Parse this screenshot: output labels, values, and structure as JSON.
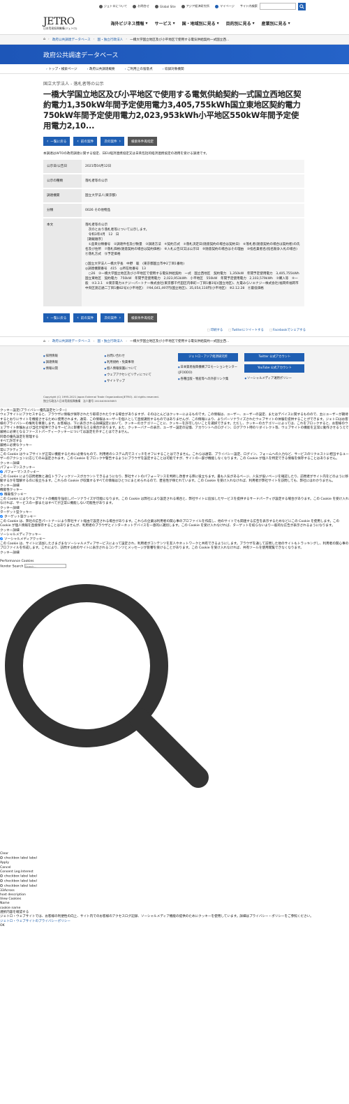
{
  "util": {
    "about": "ジェトロについて",
    "contact": "お問合せ",
    "global": "Global Site",
    "ide": "アジア経済研究所",
    "mypage": "マイページ",
    "search_label": "サイト内検索"
  },
  "logo": {
    "mark": "JETRO",
    "sub": "日本貿易振興機構(ジェトロ)"
  },
  "gnav": [
    "海外ビジネス情報",
    "サービス",
    "国・地域別に見る",
    "目的別に見る",
    "産業別に見る"
  ],
  "crumb": [
    "政府公共調達データベース",
    "国・独立行政法人",
    "一橋大学国立地区及び小平地区で使用する電気供給契約一式国立西..."
  ],
  "banner": "政府公共調達データベース",
  "subnav": [
    "トップ・検索ページ",
    "政府公共調達概要",
    "ご利用上の留意点",
    "収録対象機関"
  ],
  "category": "国立大学法人 - 落札者等の公示",
  "title": "一橋大学国立地区及び小平地区で使用する電気供給契約一式国立西地区契約電力1,350kW年間予定使用電力3,405,755kWh国立東地区契約電力750kW年間予定使用電力2,023,953kWh小平地区550kW年間予定使用電力2,10...",
  "buttons": {
    "back": "一覧に戻る",
    "prev": "前の案件",
    "next": "次の案件",
    "related": "検索条件再指定"
  },
  "note": "本調達はWTOの政府調達に関する協定、日EU経済連携協定又は日英包括的経済連携協定の適用を受ける調達です。",
  "table": [
    {
      "k": "公示日/公告日",
      "v": "2021年04月12日"
    },
    {
      "k": "公示の種類",
      "v": "落札者等の公示"
    },
    {
      "k": "調達機関",
      "v": "国立大学法人(東京都)"
    },
    {
      "k": "分類",
      "v": "0026 その他物品"
    }
  ],
  "body_label": "本文",
  "body_text": [
    "落札者等の公示",
    "　次のとおり落札者等について公示します。",
    "　令和3年4月　12　日",
    "［期載順序］",
    "　①品目分類番号　②調達件名及び数量　③調達方法　④契約方式　⑤落札決定日(随意契約の場合は契約日)　⑥落札者(随意契約の場合は契約者)の氏名及び住所　⑦落札価格(随意契約の場合は契約価格)　⑧入札公告日又は公示日　⑨随意契約の場合はその理由　⑩指名業者名(指名競争入札の場合)　⑪落札方式　⑫予定価格",
    "",
    "○国立大学法人一橋大学長　中野　聡　(東京都国立市中2丁目1番地)",
    "◎調達機関番号　415　◎所在地番号　13",
    "　○26　②一橋大学国立地区及び小平地区で使用する電気供給契約　一式　国立西地区　契約電力　1,350kW　年間予定使用電力　3,405,755kWh　国立東地区　契約電力　750kW　年間予定使用電力　2,023,953kWh　小平地区　550kW　年間予定使用電力　2,103,579kWh　③購入等　④一般　⑤3.3.1　⑥東京電力エナジーパートナー株式会社(東京都千代田区内幸町一丁目1番3号)(国立地区)、九電みらいエナジー株式会社(福岡県福岡市中央区渡辺通二丁目1番82号)(小平地区)　⑦94,041,497円(国立地区)、35,054,110円(小平地区)　⑧2.12.28　⑪最低価格"
  ],
  "share": [
    "印刷する",
    "Twitterにツイートする",
    "Facebookでシェアする"
  ],
  "crumb2": [
    "政府公共調達データベース",
    "国・独立行政法人",
    "一橋大学国立地区及び小平地区で使用する電気供給契約一式国立西..."
  ],
  "footer": {
    "col1": [
      "採用情報",
      "調達情報",
      "情報公開"
    ],
    "col2": [
      "お問い合わせ",
      "利用規約・免責事項",
      "個人情報保護について",
      "ウェブアクセシビリティについて",
      "サイトマップ"
    ],
    "col3_btn": "ジェトロ・アジア経済研究所",
    "col3_links": [
      "日本貿易振興機構プロモーションセンター(JFOODO)",
      "各種出版・物産等への外部リンク集"
    ],
    "col4_btns": [
      "Twitter 公式アカウント",
      "YouTube 公式アカウント"
    ],
    "col4_link": "ソーシャルメディア運用ポリシー",
    "copyright": "Copyright (C) 1995-2021 Japan External Trade Organization(JETRO). All rights reserved.",
    "corp": "独立行政法人日本貿易振興機構　法人番号 2010405003693"
  },
  "cookie": {
    "heading": "クッキー設定(プライバシー優先設定センター)",
    "intro": "ウェブサイトにアクセスすると、ブラウザに情報が保存されたり取得されたりする場合がありますが、そのほとんどはクッキーによるものです。この情報は、ユーザー、ユーザーの設定、またはデバイスに関するものので、主にユーザーが期待するとおりにサイトを機能させるために使用されます。通常、この情報はユーザーを個人として直接識別するものではありませんが、この情報により、よりパーソナライズされたウェブサイトの体験を提供することができます。ジェトロはお客様のプライバシーの権利を尊重します。お客様は、下に表示される詳細設定において、クッキーのカテゴリーごとに、クッキーを許可しないことを選択できます。ただし、クッキーのカテゴリーによっては、これをブロックすると、お客様のウェブサイト体験および当社が提供できるサービスに影響を与える場合があります。また、クッキーバナーの表示、ユーザー設定の記憶、アカウントへのログイン、ログアウト時のリダイレクト等、ウェブサイトの機能を正常に動作させるうえで厳格に必要となるファーストパーティークッキーについては設定を外すことはできません。",
    "manage": "同意の優先設定を管理する",
    "strict": "厳格に必要なクッキー",
    "always": "常にアクティブ",
    "strict_desc": "この Cookie はウェブサイトが正常に機能するために必要なもので、利用者のシステム内でスイッチをオフにすることはできません。これらは通常、プライバシー設定、ログイン、フォームへの入力など、サービスのリクエストに相当するユーザーのアクションに応じてのみ設定されます。この Cookie をブロックや警告するようにブラウザを設定することは可能ですが、サイトの一部が機能しなくなります。この Cookie が個人を特定できる情報を保存することはありません。",
    "detail": "クッキー詳細",
    "perf": "パフォーマンスクッキー",
    "perf_desc": "この Cookie により訪問者数と通信トラフィックソースがカウントできるようになり、弊社サイトのパフォーマンスを判断し改善する際に役立ちます。最も人気があるページ、人気が低いページを確認したり、訪問者がサイト内をどのように移動するかを理解するのに役立ちます。これらの Cookie が収集するすべての情報はひとつにまとめられるので、匿名性が保たれています。この Cookie を受け入れなければ、利用者が弊社サイトを訪問しても、弊社にはわかりません。",
    "func": "機能性クッキー",
    "func_desc": "この Cookie によりウェブサイトの機能を強化しパーソナライズが可能になります。この Cookie は弊社により設定される場合と、弊社サイトに追加したサービスを提供するサードパーティが設定する場合があります。この Cookie を受け入れなければ、サービスの一部またはすべてが正常に機能しない可能性があります。",
    "target": "ターゲット型クッキー",
    "target_desc": "この Cookie は、弊社の広告パートナーにより弊社サイト経由で設定される場合があります。これらの企業は利用者の関心事のプロファイルを作成し、他のサイトでも関連する広告を表示するためなどにこの Cookie を使用します。この Cookie が個人情報を直接保存することはありませんが、利用者のブラウザとインターネットデバイスを一意的に識別します。この Cookie を受け入れなければ、ターゲットを絞らないより一般的な広告が表示されるようになります。",
    "social": "ソーシャルメディアクッキー",
    "social_desc": "この Cookie は、サイトに追加したさまざまなソーシャルメディアサービスによって設定され、利用者がコンテンツを友人やネットワークと共有できるようにします。ブラウザを通して訪問した他のサイトもトラッキングし、利用者の関心事のプロファイルを作成します。これにより、訪問する他のサイトに表示されるコンテンツとメッセージが影響を受けることがあります。この Cookie を受け入れなければ、共有ツールを使用閲覧できなくなります。",
    "perf_title": "Performance Cookies",
    "vendor_search": "Vendor Search",
    "search_placeholder": "Search...",
    "clear": "Clear",
    "cb_label": "checkbox label label",
    "apply": "Apply",
    "cancel": "Cancel",
    "consent": "Consent Leg.Interest",
    "across": "33Across",
    "host": "host description",
    "view": "View Cookies",
    "name": "Name",
    "cookie_name": "cookie name",
    "confirm": "選択内容を確認する",
    "footer_note": "ジェトロ・ウェブサイトでは、お客様の利便性の向上、サイト内でのお客様のアクセスログ記録、ソーシャルメディア機能の提供のためにクッキーを使用しています。詳細はプライバシー・ポリシーをご参照ください。",
    "policy": "ジェトロ・ウェブサイトのプライバシーポリシー",
    "ok": "OK",
    "or": "すべて許可する"
  },
  "colors": {
    "brand": "#1f5fb3",
    "banner": "#1d56b8"
  }
}
